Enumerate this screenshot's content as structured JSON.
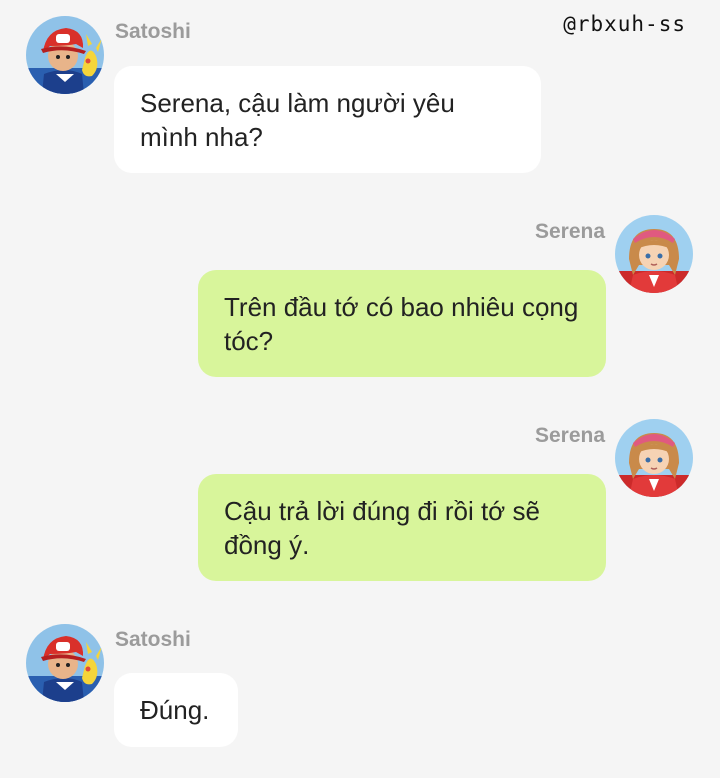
{
  "watermark": "@rbxuh-ss",
  "messages": [
    {
      "sender": "Satoshi",
      "direction": "incoming",
      "avatar": "satoshi-avatar-icon",
      "text": "Serena, cậu làm người yêu mình nha?"
    },
    {
      "sender": "Serena",
      "direction": "outgoing",
      "avatar": "serena-avatar-icon",
      "text": "Trên đầu tớ có bao nhiêu cọng tóc?"
    },
    {
      "sender": "Serena",
      "direction": "outgoing",
      "avatar": "serena-avatar-icon",
      "text": "Cậu trả lời đúng đi rồi tớ sẽ đồng ý."
    },
    {
      "sender": "Satoshi",
      "direction": "incoming",
      "avatar": "satoshi-avatar-icon",
      "text": "Đúng."
    }
  ],
  "colors": {
    "background": "#f5f5f5",
    "incoming_bubble": "#ffffff",
    "outgoing_bubble": "#d8f59b",
    "sender_name": "#9b9b9b"
  }
}
